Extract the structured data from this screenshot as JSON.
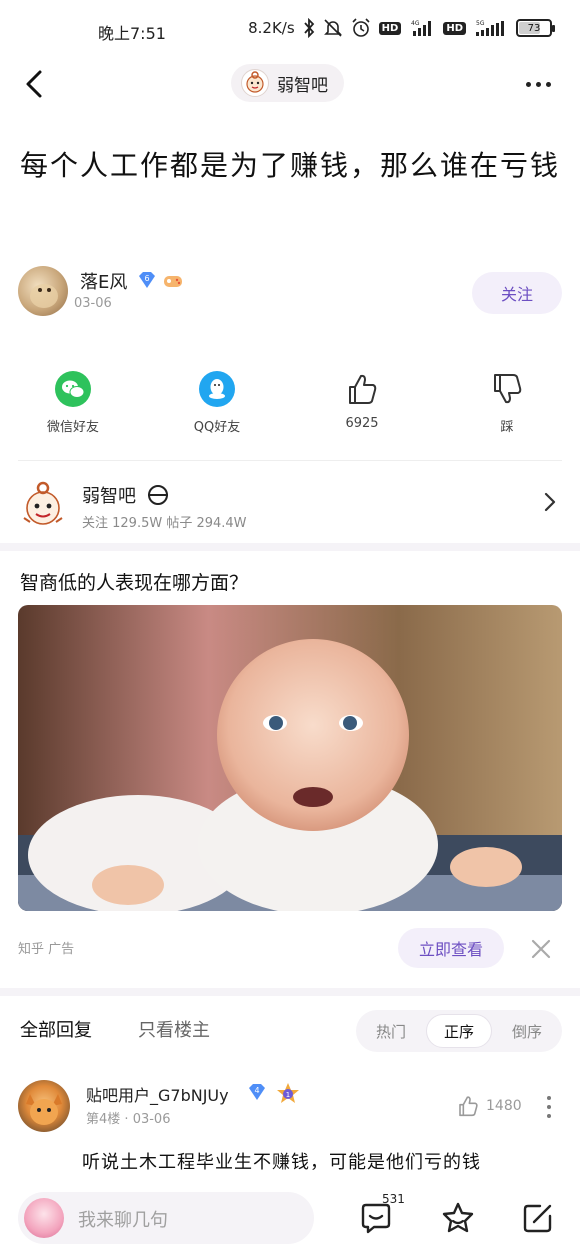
{
  "status_bar": {
    "time": "晚上7:51",
    "network_speed": "8.2K/s",
    "hd1": "HD",
    "net1": "4G",
    "hd2": "HD",
    "net2": "5G",
    "battery": "73"
  },
  "nav": {
    "forum_name": "弱智吧"
  },
  "post": {
    "title": "每个人工作都是为了赚钱，那么谁在亏钱",
    "author": {
      "name": "落E风",
      "level": "6",
      "date": "03-06"
    },
    "follow_label": "关注"
  },
  "share": {
    "wechat_label": "微信好友",
    "qq_label": "QQ好友",
    "like_count": "6925",
    "dislike_label": "踩"
  },
  "forum_card": {
    "name": "弱智吧",
    "stats": "关注 129.5W  帖子 294.4W"
  },
  "ad": {
    "title": "智商低的人表现在哪方面？",
    "source": "知乎 广告",
    "cta_label": "立即查看"
  },
  "reply_tabs": {
    "all_label": "全部回复",
    "owner_label": "只看楼主",
    "sort": {
      "hot": "热门",
      "asc": "正序",
      "desc": "倒序",
      "active": "asc"
    }
  },
  "comments": [
    {
      "user": "贴吧用户_G7bNJUy",
      "level": "4",
      "badge_number": "1",
      "floor": "第4楼",
      "date": "03-06",
      "likes": "1480",
      "text": "听说土木工程毕业生不赚钱，可能是他们亏的钱"
    }
  ],
  "bottom_bar": {
    "input_placeholder": "我来聊几句",
    "reply_count": "531"
  },
  "colors": {
    "accent": "#6d4fc2",
    "wechat": "#2ec25c",
    "qq": "#21a6f0",
    "badge_blue": "#4f8ef7"
  }
}
